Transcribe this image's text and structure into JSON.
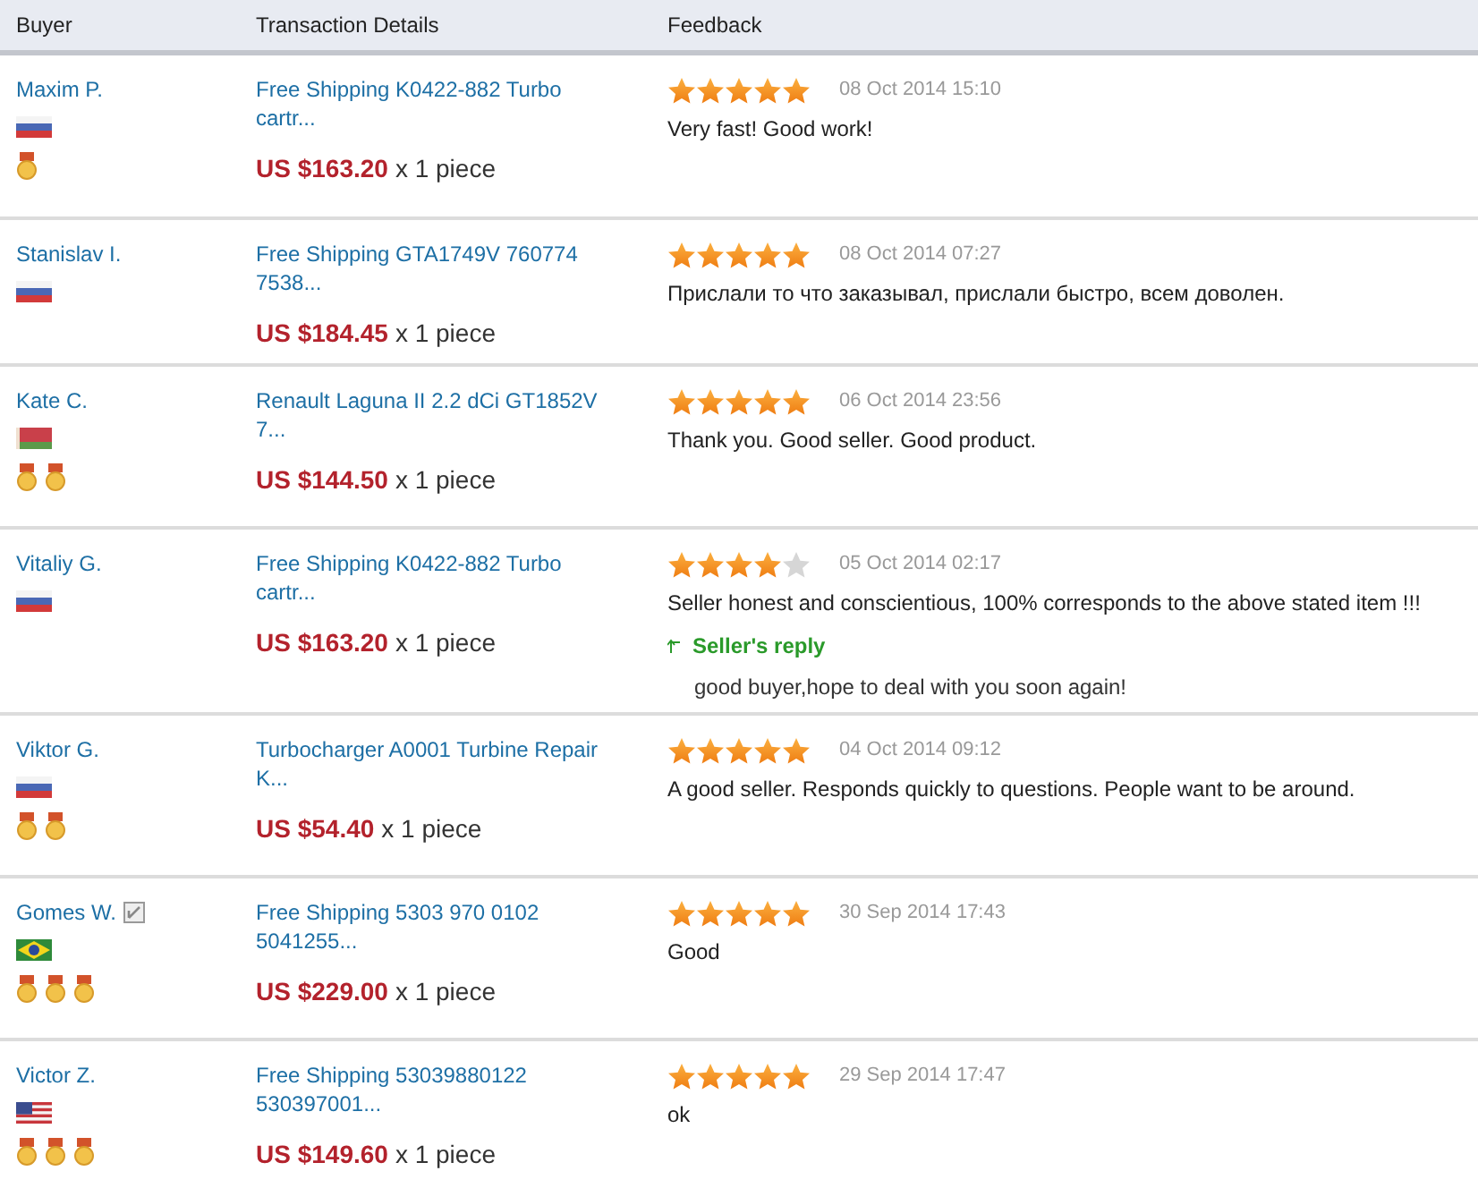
{
  "table": {
    "columns": [
      "Buyer",
      "Transaction Details",
      "Feedback"
    ],
    "rows": [
      {
        "buyer": "Maxim P.",
        "flag": {
          "kind": "ru"
        },
        "note_icon": false,
        "medals": [
          {
            "kind": "medal"
          }
        ],
        "item": "Free Shipping K0422-882 Turbo cartr...",
        "price": "US $163.20",
        "quantity": "x 1 piece",
        "stars": 5,
        "date": "08 Oct 2014 15:10",
        "comment": "Very fast! Good work!"
      },
      {
        "buyer": "Stanislav I.",
        "flag": {
          "kind": "ru"
        },
        "note_icon": false,
        "medals": [],
        "item": "Free Shipping GTA1749V 760774 7538...",
        "price": "US $184.45",
        "quantity": "x 1 piece",
        "stars": 5,
        "date": "08 Oct 2014 07:27",
        "comment": "Прислали то что заказывал, прислали быстро, всем доволен."
      },
      {
        "buyer": "Kate C.",
        "flag": {
          "kind": "by"
        },
        "note_icon": false,
        "medals": [
          {
            "kind": "medal"
          },
          {
            "kind": "medal"
          }
        ],
        "item": "Renault Laguna II 2.2 dCi GT1852V 7...",
        "price": "US $144.50",
        "quantity": "x 1 piece",
        "stars": 5,
        "date": "06 Oct 2014 23:56",
        "comment": "Thank you. Good seller. Good product."
      },
      {
        "buyer": "Vitaliy G.",
        "flag": {
          "kind": "ru"
        },
        "note_icon": false,
        "medals": [],
        "item": "Free Shipping K0422-882 Turbo cartr...",
        "price": "US $163.20",
        "quantity": "x 1 piece",
        "stars": 4,
        "date": "05 Oct 2014 02:17",
        "comment": "Seller honest and conscientious, 100% corresponds to the above stated item !!!",
        "reply": {
          "label": "Seller's reply",
          "text": "good buyer,hope to deal with you soon again!"
        }
      },
      {
        "buyer": "Viktor G.",
        "flag": {
          "kind": "ru"
        },
        "note_icon": false,
        "medals": [
          {
            "kind": "medal"
          },
          {
            "kind": "medal"
          }
        ],
        "item": "Turbocharger A0001 Turbine Repair K...",
        "price": "US $54.40",
        "quantity": "x 1 piece",
        "stars": 5,
        "date": "04 Oct 2014 09:12",
        "comment": "A good seller. Responds quickly to questions. People want to be around."
      },
      {
        "buyer": "Gomes W.",
        "flag": {
          "kind": "br"
        },
        "note_icon": true,
        "medals": [
          {
            "kind": "medal"
          },
          {
            "kind": "medal"
          },
          {
            "kind": "medal"
          }
        ],
        "item": "Free Shipping 5303 970 0102 5041255...",
        "price": "US $229.00",
        "quantity": "x 1 piece",
        "stars": 5,
        "date": "30 Sep 2014 17:43",
        "comment": "Good"
      },
      {
        "buyer": "Victor Z.",
        "flag": {
          "kind": "us"
        },
        "note_icon": false,
        "medals": [
          {
            "kind": "medal"
          },
          {
            "kind": "medal"
          },
          {
            "kind": "medal"
          }
        ],
        "item": "Free Shipping 53039880122 530397001...",
        "price": "US $149.60",
        "quantity": "x 1 piece",
        "stars": 5,
        "date": "29 Sep 2014 17:47",
        "comment": "ok"
      }
    ]
  }
}
